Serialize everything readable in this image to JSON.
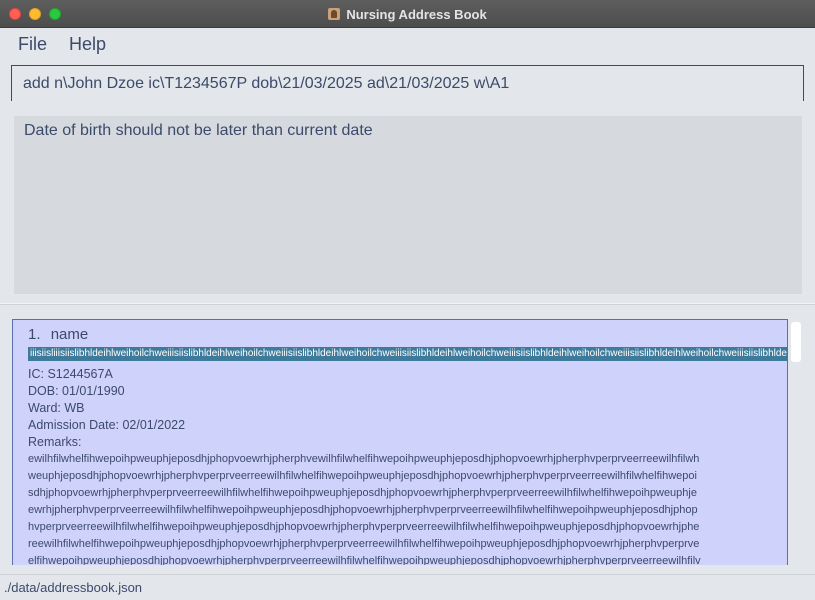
{
  "window": {
    "title": "Nursing Address Book",
    "app_icon": "address-book-icon"
  },
  "menu": {
    "file": "File",
    "help": "Help"
  },
  "command": {
    "value": "add n\\John Dzoe ic\\T1234567P dob\\21/03/2025 ad\\21/03/2025 w\\A1"
  },
  "result": {
    "message": "Date of birth should not be later than current date"
  },
  "persons": [
    {
      "index": "1.",
      "name": "name",
      "tag": "iiisiisliiisiislibhldeihlweihoilchweiiisiislibhldeihlweihoilchweiiisiislibhldeihlweihoilchweiiisiislibhldeihlweihoilchweiiisiislibhldeihlweihoilchweiiisiislibhldeihlweihoilchweiiisiislibhldeihlweihoilchweiiisiislibhldeihlweihoilchweiiisiisl",
      "ic": "IC: S1244567A",
      "dob": "DOB: 01/01/1990",
      "ward": "Ward: WB",
      "admission": "Admission Date: 02/01/2022",
      "remarks_label": "Remarks:",
      "remarks_lines": [
        "ewilhfilwhelfihwepoihpweuphjeposdhjphopvoewrhjpherphvewilhfilwhelfihwepoihpweuphjeposdhjphopvoewrhjpherphvperprveerreewilhfilwh",
        "weuphjeposdhjphopvoewrhjpherphvperprveerreewilhfilwhelfihwepoihpweuphjeposdhjphopvoewrhjpherphvperprveerreewilhfilwhelfihwepoi",
        "sdhjphopvoewrhjpherphvperprveerreewilhfilwhelfihwepoihpweuphjeposdhjphopvoewrhjpherphvperprveerreewilhfilwhelfihwepoihpweuphje",
        "ewrhjpherphvperprveerreewilhfilwhelfihwepoihpweuphjeposdhjphopvoewrhjpherphvperprveerreewilhfilwhelfihwepoihpweuphjeposdhjphop",
        "hvperprveerreewilhfilwhelfihwepoihpweuphjeposdhjphopvoewrhjpherphvperprveerreewilhfilwhelfihwepoihpweuphjeposdhjphopvoewrhjphe",
        "reewilhfilwhelfihwepoihpweuphjeposdhjphopvoewrhjpherphvperprveerreewilhfilwhelfihwepoihpweuphjeposdhjphopvoewrhjpherphvperprve",
        "elfihwepoihpweuphjeposdhjphopvoewrhjpherphvperprveerreewilhfilwhelfihwepoihpweuphjeposdhjphopvoewrhjpherphvperprveerreewilhfilv"
      ]
    }
  ],
  "status": {
    "path": "./data/addressbook.json"
  }
}
